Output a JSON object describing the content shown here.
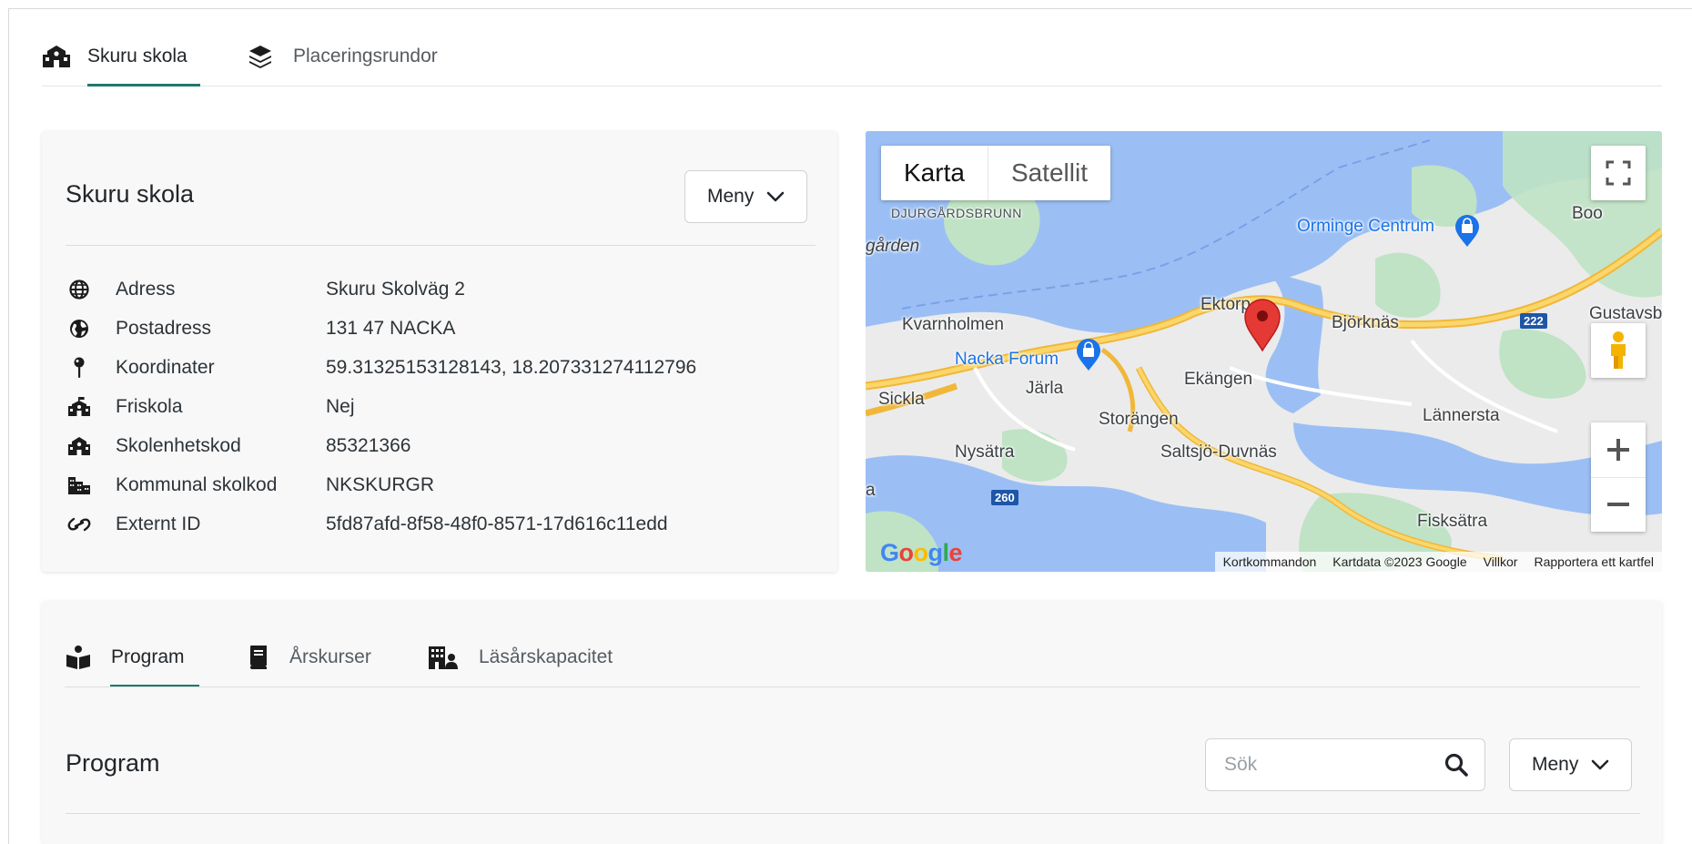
{
  "top_tabs": [
    {
      "label": "Skuru skola",
      "icon": "school-icon",
      "active": true
    },
    {
      "label": "Placeringsrundor",
      "icon": "layers-icon",
      "active": false
    }
  ],
  "school": {
    "title": "Skuru skola",
    "menu_label": "Meny",
    "fields": [
      {
        "icon": "globe-icon",
        "label": "Adress",
        "value": "Skuru Skolväg 2"
      },
      {
        "icon": "earth-icon",
        "label": "Postadress",
        "value": "131 47 NACKA"
      },
      {
        "icon": "pin-icon",
        "label": "Koordinater",
        "value": "59.31325153128143, 18.207331274112796"
      },
      {
        "icon": "school-icon",
        "label": "Friskola",
        "value": "Nej"
      },
      {
        "icon": "school-icon",
        "label": "Skolenhetskod",
        "value": "85321366"
      },
      {
        "icon": "city-icon",
        "label": "Kommunal skolkod",
        "value": "NKSKURGR"
      },
      {
        "icon": "link-icon",
        "label": "Externt ID",
        "value": "5fd87afd-8f58-48f0-8571-17d616c11edd"
      }
    ]
  },
  "map": {
    "type_map": "Karta",
    "type_satellite": "Satellit",
    "labels": {
      "djurgardsbrunn": "DJURGÅRDSBRUNN",
      "garden": "gården",
      "orminge": "Orminge Centrum",
      "boo": "Boo",
      "ektorp": "Ektorp",
      "bjorknas": "Björknäs",
      "gustavsberg": "Gustavsb",
      "kvarnholmen": "Kvarnholmen",
      "nacka_forum": "Nacka Forum",
      "jarla": "Järla",
      "ekangen": "Ekängen",
      "sickla": "Sickla",
      "storangen": "Storängen",
      "lannersta": "Lännersta",
      "nysatra": "Nysätra",
      "saltsjo": "Saltsjö-Duvnäs",
      "a": "a",
      "fisksatra": "Fisksätra"
    },
    "road_222": "222",
    "road_260": "260",
    "google": "Google",
    "attribution": {
      "shortcuts": "Kortkommandon",
      "data": "Kartdata ©2023 Google",
      "terms": "Villkor",
      "report": "Rapportera ett kartfel"
    }
  },
  "lower_tabs": [
    {
      "label": "Program",
      "icon": "book-reader-icon",
      "active": true
    },
    {
      "label": "Årskurser",
      "icon": "book-icon",
      "active": false
    },
    {
      "label": "Läsårskapacitet",
      "icon": "building-user-icon",
      "active": false
    }
  ],
  "program": {
    "title": "Program",
    "search_placeholder": "Sök",
    "menu_label": "Meny"
  },
  "colors": {
    "accent": "#1f7a6d",
    "water": "#9bbff4",
    "park": "#bfe3c4",
    "road": "#f7c94a",
    "marker": "#e53935"
  }
}
